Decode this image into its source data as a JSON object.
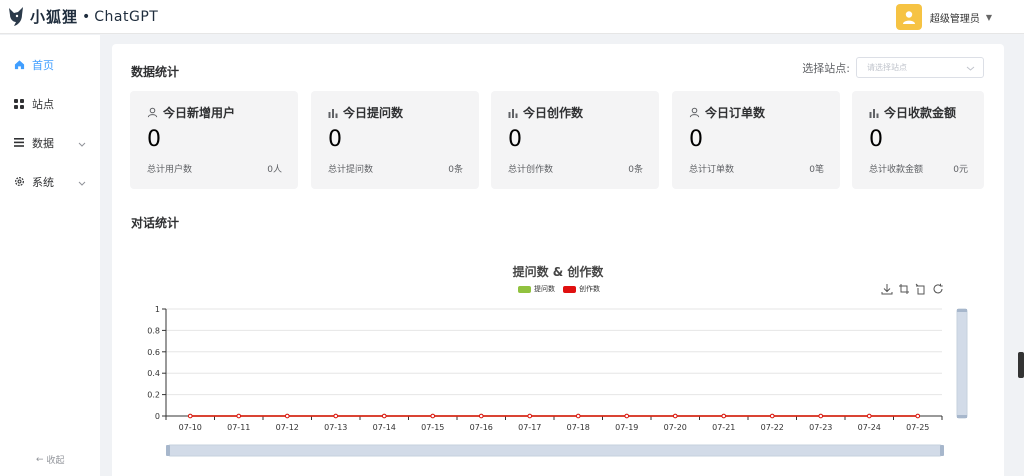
{
  "header": {
    "brand": "小狐狸",
    "dot": "•",
    "product": "ChatGPT",
    "username": "超级管理员"
  },
  "sidebar": {
    "items": [
      {
        "label": "首页",
        "icon": "home-icon",
        "active": true
      },
      {
        "label": "站点",
        "icon": "grid-icon",
        "active": false
      },
      {
        "label": "数据",
        "icon": "list-icon",
        "active": false,
        "expandable": true
      },
      {
        "label": "系统",
        "icon": "gear-icon",
        "active": false,
        "expandable": true
      }
    ],
    "collapse_label": "收起"
  },
  "stats": {
    "title": "数据统计",
    "site_label": "选择站点:",
    "site_placeholder": "请选择站点",
    "cards": [
      {
        "title": "今日新增用户",
        "icon": "user-icon",
        "value": "0",
        "foot_label": "总计用户数",
        "foot_value": "0人"
      },
      {
        "title": "今日提问数",
        "icon": "bar-chart-icon",
        "value": "0",
        "foot_label": "总计提问数",
        "foot_value": "0条"
      },
      {
        "title": "今日创作数",
        "icon": "bar-chart-icon",
        "value": "0",
        "foot_label": "总计创作数",
        "foot_value": "0条"
      },
      {
        "title": "今日订单数",
        "icon": "user-icon",
        "value": "0",
        "foot_label": "总计订单数",
        "foot_value": "0笔"
      },
      {
        "title": "今日收款金额",
        "icon": "bar-chart-icon",
        "value": "0",
        "foot_label": "总计收款金额",
        "foot_value": "0元"
      }
    ]
  },
  "dialog": {
    "title": "对话统计"
  },
  "colors": {
    "accent": "#409eff",
    "series_questions": "#91c23f",
    "series_creations": "#e01010"
  },
  "chart_data": {
    "type": "line",
    "title": "提问数 & 创作数",
    "categories": [
      "07-10",
      "07-11",
      "07-12",
      "07-13",
      "07-14",
      "07-15",
      "07-16",
      "07-17",
      "07-18",
      "07-19",
      "07-20",
      "07-21",
      "07-22",
      "07-23",
      "07-24",
      "07-25"
    ],
    "series": [
      {
        "name": "提问数",
        "values": [
          0,
          0,
          0,
          0,
          0,
          0,
          0,
          0,
          0,
          0,
          0,
          0,
          0,
          0,
          0,
          0
        ]
      },
      {
        "name": "创作数",
        "values": [
          0,
          0,
          0,
          0,
          0,
          0,
          0,
          0,
          0,
          0,
          0,
          0,
          0,
          0,
          0,
          0
        ]
      }
    ],
    "y_ticks": [
      "0",
      "0.2",
      "0.4",
      "0.6",
      "0.8",
      "1"
    ],
    "ylim": [
      0,
      1
    ],
    "grid": true,
    "legend_position": "top-center"
  }
}
